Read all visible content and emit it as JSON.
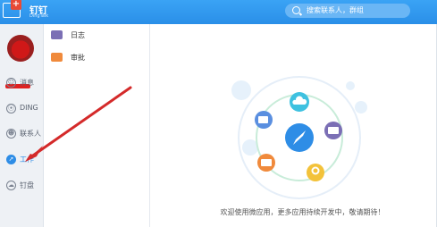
{
  "titlebar": {
    "app_name": "钉钉",
    "app_sub": "DingTalk",
    "search_placeholder": "搜索联系人，群组",
    "accent": "#2e8de6"
  },
  "sidebar": {
    "items": [
      {
        "label": "消息",
        "icon": "message-icon"
      },
      {
        "label": "DING",
        "icon": "ding-icon"
      },
      {
        "label": "联系人",
        "icon": "contacts-icon"
      },
      {
        "label": "工作",
        "icon": "work-compass-icon",
        "active": true
      },
      {
        "label": "钉盘",
        "icon": "cloud-drive-icon"
      }
    ]
  },
  "apps": [
    {
      "label": "日志",
      "icon": "log-icon",
      "color": "#7b6fb5"
    },
    {
      "label": "审批",
      "icon": "approval-icon",
      "color": "#f08a3c"
    }
  ],
  "content": {
    "caption": "欢迎使用微应用，更多应用持续开发中，敬请期待！"
  }
}
